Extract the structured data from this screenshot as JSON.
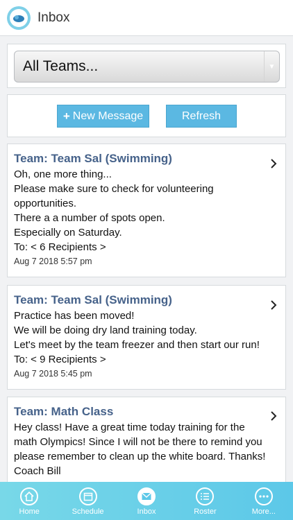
{
  "header": {
    "title": "Inbox",
    "logo_icon": "whistle-logo-icon"
  },
  "team_select": {
    "value": "All Teams..."
  },
  "actions": {
    "new_message": "New Message",
    "refresh": "Refresh"
  },
  "messages": [
    {
      "team": "Team: Team Sal (Swimming)",
      "lines": [
        "Oh, one more thing...",
        "Please make sure to check for volunteering",
        "opportunities.",
        "There a a number of spots open.",
        "Especially on Saturday."
      ],
      "to": "To: < 6 Recipients >",
      "date": "Aug 7 2018 5:57 pm"
    },
    {
      "team": "Team: Team Sal (Swimming)",
      "lines": [
        "Practice has been moved!",
        "We will be doing dry land training today.",
        "Let's meet by the team freezer and then start our run!"
      ],
      "to": "To: < 9 Recipients >",
      "date": "Aug 7 2018 5:45 pm"
    },
    {
      "team": "Team: Math Class",
      "lines": [
        "Hey class! Have a great time today training for the",
        "math Olympics! Since I will not be there to remind you",
        "please remember to clean up the white board. Thanks!",
        "Coach Bill"
      ]
    }
  ],
  "tabs": [
    {
      "label": "Home",
      "icon": "home-icon",
      "active": false
    },
    {
      "label": "Schedule",
      "icon": "calendar-icon",
      "active": false
    },
    {
      "label": "Inbox",
      "icon": "envelope-icon",
      "active": true
    },
    {
      "label": "Roster",
      "icon": "list-icon",
      "active": false
    },
    {
      "label": "More...",
      "icon": "more-icon",
      "active": false
    }
  ],
  "colors": {
    "accent": "#5bb8e2",
    "team_title": "#46628a",
    "tabbar": "#6ad0e8"
  }
}
